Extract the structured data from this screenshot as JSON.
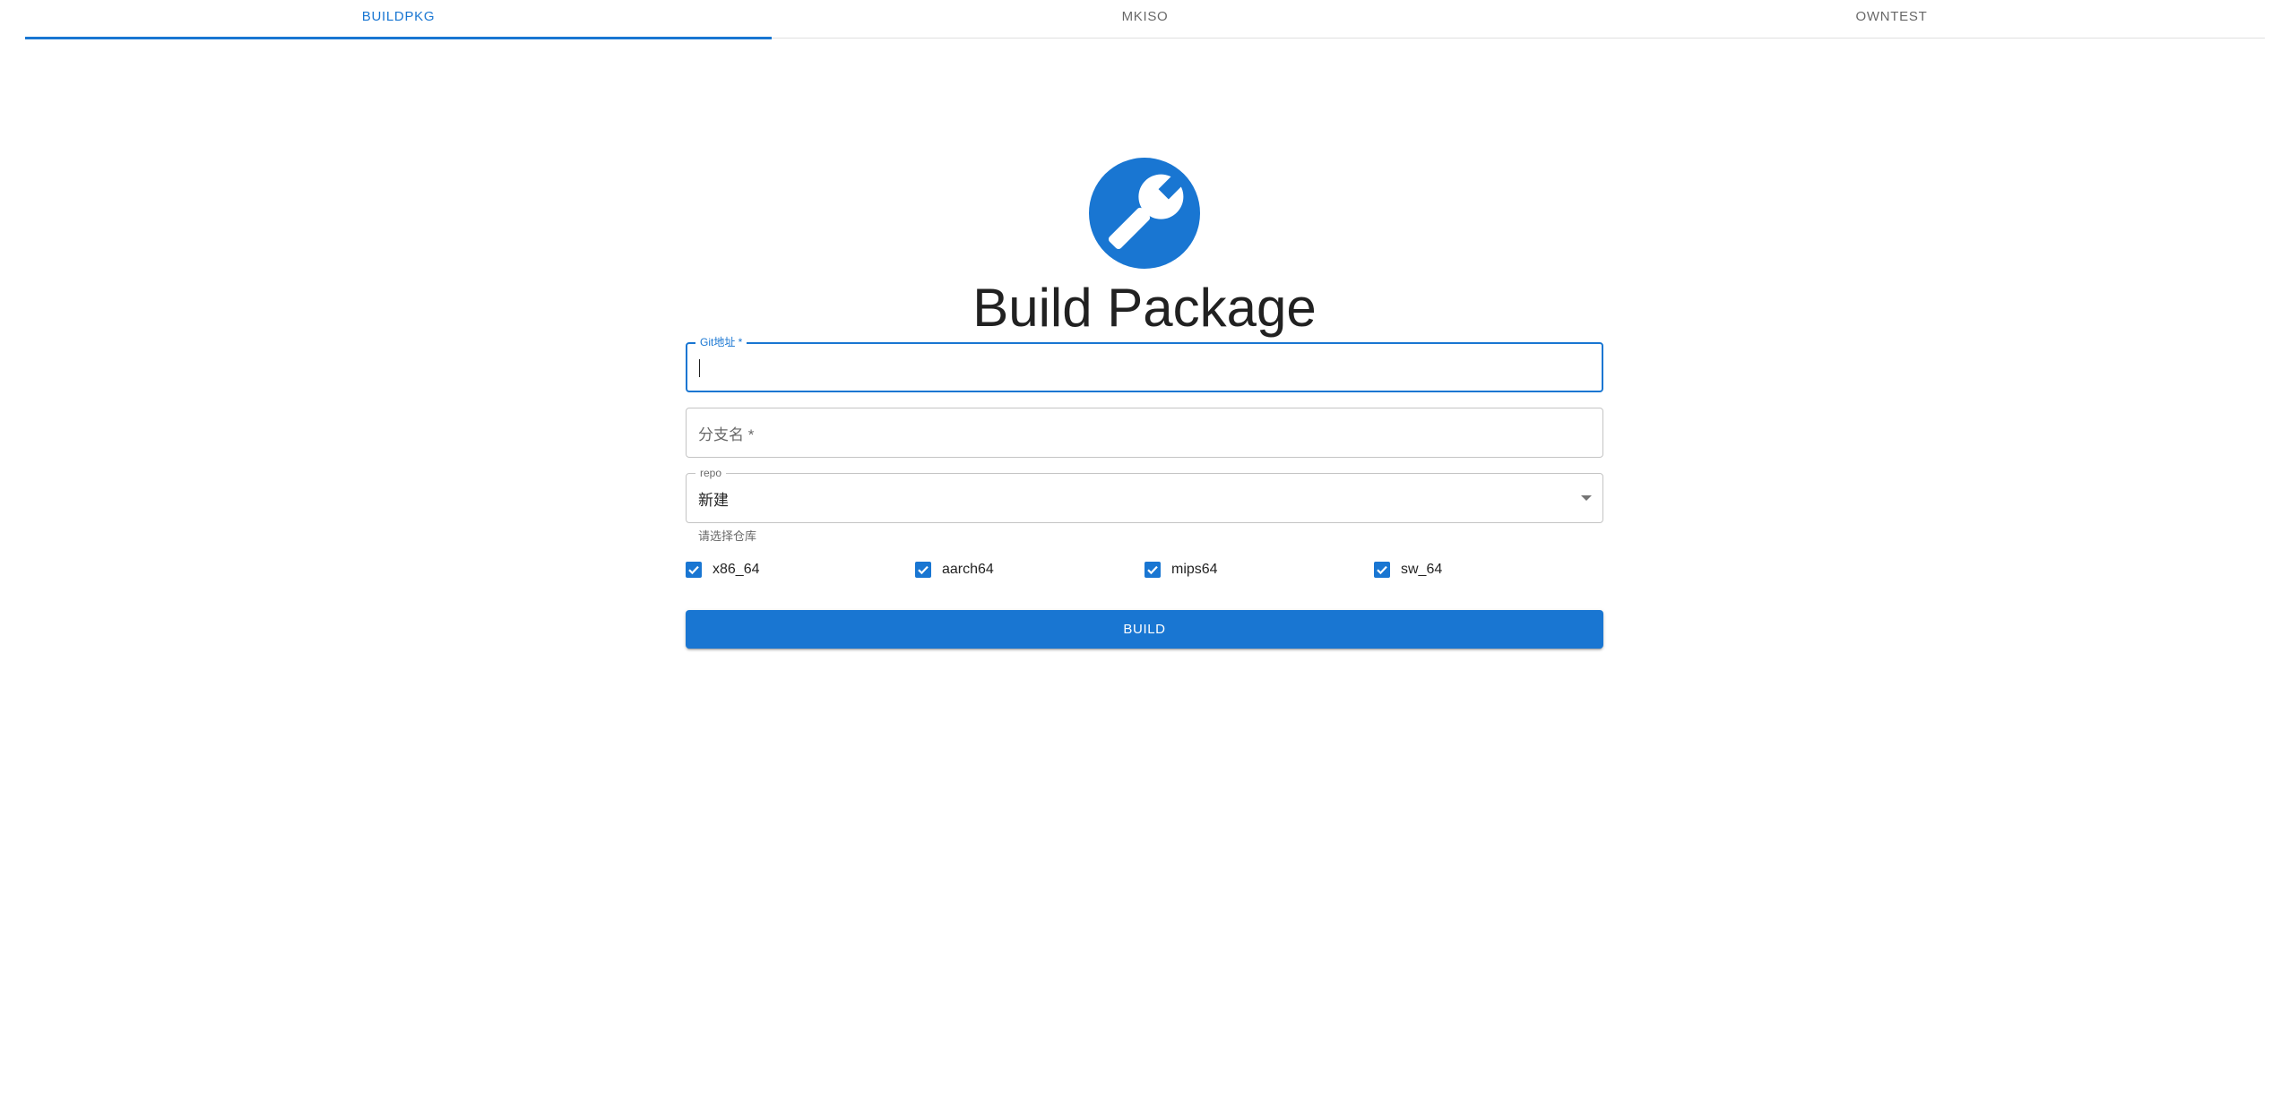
{
  "tabs": [
    {
      "label": "BUILDPKG",
      "active": true
    },
    {
      "label": "MKISO",
      "active": false
    },
    {
      "label": "OWNTEST",
      "active": false
    }
  ],
  "header": {
    "icon": "wrench-icon",
    "title": "Build Package"
  },
  "form": {
    "git_url": {
      "label": "Git地址 *",
      "value": ""
    },
    "branch": {
      "placeholder": "分支名 *",
      "value": ""
    },
    "repo": {
      "label": "repo",
      "value": "新建",
      "helper": "请选择仓库"
    },
    "architectures": [
      {
        "label": "x86_64",
        "checked": true
      },
      {
        "label": "aarch64",
        "checked": true
      },
      {
        "label": "mips64",
        "checked": true
      },
      {
        "label": "sw_64",
        "checked": true
      }
    ],
    "build_label": "BUILD"
  },
  "colors": {
    "primary": "#1976d2",
    "text": "#212121",
    "border": "#c4c4c4"
  }
}
